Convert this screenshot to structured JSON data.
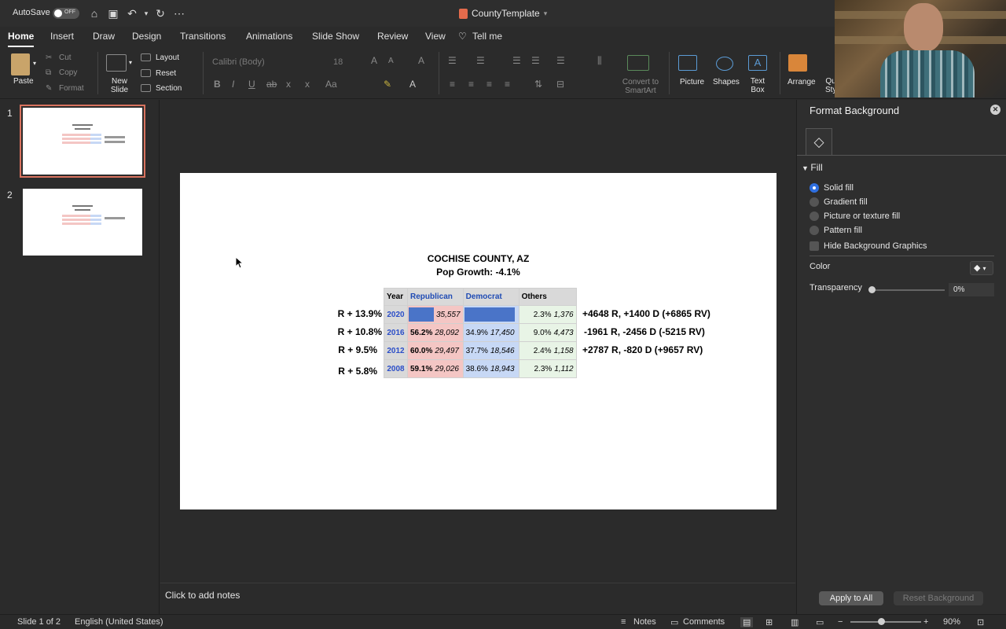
{
  "titlebar": {
    "autosave_label": "AutoSave",
    "autosave_state": "OFF",
    "document_title": "CountyTemplate"
  },
  "tabs": [
    "Home",
    "Insert",
    "Draw",
    "Design",
    "Transitions",
    "Animations",
    "Slide Show",
    "Review",
    "View",
    "Tell me"
  ],
  "ribbon": {
    "paste": "Paste",
    "cut": "Cut",
    "copy": "Copy",
    "format": "Format",
    "new_slide": "New Slide",
    "layout": "Layout",
    "reset": "Reset",
    "section": "Section",
    "font_name": "Calibri (Body)",
    "font_size": "18",
    "convert_smartart": "Convert to SmartArt",
    "picture": "Picture",
    "shapes": "Shapes",
    "text_box": "Text Box",
    "arrange": "Arrange",
    "quick_styles_partial": "Qu Sty"
  },
  "thumbnails": [
    {
      "number": "1",
      "selected": true
    },
    {
      "number": "2",
      "selected": false
    }
  ],
  "slide": {
    "title_line1": "COCHISE COUNTY, AZ",
    "title_line2": "Pop Growth: -4.1%",
    "headers": {
      "year": "Year",
      "rep": "Republican",
      "dem": "Democrat",
      "oth": "Others"
    },
    "rows": [
      {
        "year": "2020",
        "rep_pct": "",
        "rep_count": "35,557",
        "dem_pct": "",
        "dem_count": "",
        "oth_pct": "2.3%",
        "oth_count": "1,376",
        "margin": "R + 13.9%",
        "change": "+4648 R, +1400 D (+6865 RV)"
      },
      {
        "year": "2016",
        "rep_pct": "56.2%",
        "rep_count": "28,092",
        "dem_pct": "34.9%",
        "dem_count": "17,450",
        "oth_pct": "9.0%",
        "oth_count": "4,473",
        "margin": "R + 10.8%",
        "change": "-1961 R, -2456 D (-5215 RV)"
      },
      {
        "year": "2012",
        "rep_pct": "60.0%",
        "rep_count": "29,497",
        "dem_pct": "37.7%",
        "dem_count": "18,546",
        "oth_pct": "2.4%",
        "oth_count": "1,158",
        "margin": "R + 9.5%",
        "change": "+2787 R, -820 D (+9657 RV)"
      },
      {
        "year": "2008",
        "rep_pct": "59.1%",
        "rep_count": "29,026",
        "dem_pct": "38.6%",
        "dem_count": "18,943",
        "oth_pct": "2.3%",
        "oth_count": "1,112",
        "margin": "R + 5.8%",
        "change": ""
      }
    ]
  },
  "notes_placeholder": "Click to add notes",
  "format_pane": {
    "title": "Format Background",
    "section": "Fill",
    "options": [
      "Solid fill",
      "Gradient fill",
      "Picture or texture fill",
      "Pattern fill"
    ],
    "hide_bg": "Hide Background Graphics",
    "color_label": "Color",
    "transparency_label": "Transparency",
    "transparency_value": "0%",
    "apply_all": "Apply to All",
    "reset_bg": "Reset Background"
  },
  "status": {
    "slide_info": "Slide 1 of 2",
    "language": "English (United States)",
    "notes": "Notes",
    "comments": "Comments",
    "zoom": "90%"
  },
  "colors": {
    "rep_fill": "#f4c6c4",
    "dem_fill": "#c7d8f5",
    "oth_fill": "#e8f4e6",
    "bar_blue": "#4a74c8",
    "accent_selected": "#d9735f"
  }
}
